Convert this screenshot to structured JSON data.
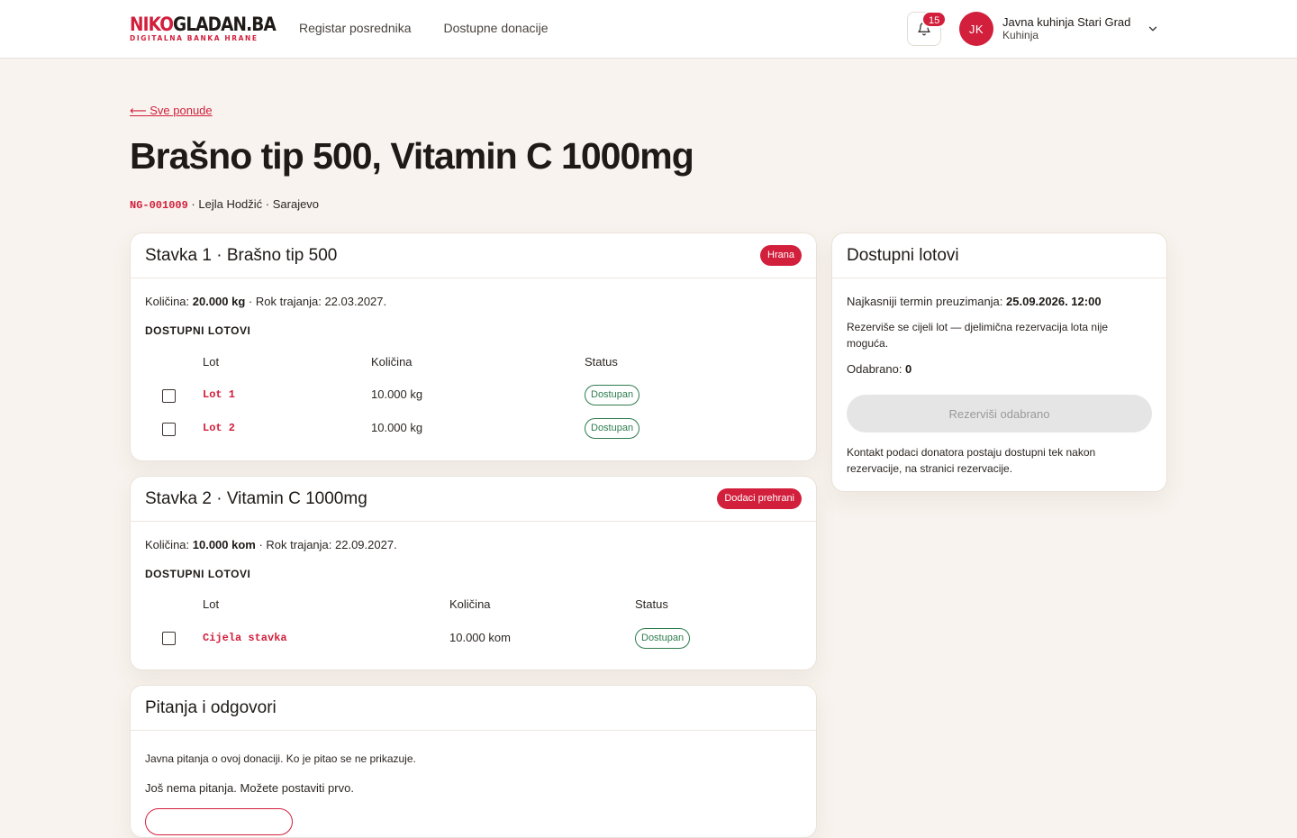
{
  "header": {
    "logo_main_red": "NIKO",
    "logo_main_dark": "GLADAN.BA",
    "logo_sub": "DIGITALNA BANKA HRANE",
    "nav": [
      "Registar posrednika",
      "Dostupne donacije"
    ],
    "notifications_count": "15",
    "account": {
      "initials": "JK",
      "name": "Javna kuhinja Stari Grad",
      "role": "Kuhinja"
    }
  },
  "page": {
    "back_link": "⟵ Sve ponude",
    "title": "Brašno tip 500, Vitamin C 1000mg",
    "code": "NG-001009",
    "meta_rest": " · Lejla Hodžić · Sarajevo"
  },
  "items": [
    {
      "title": "Stavka 1 · Brašno tip 500",
      "tag": "Hrana",
      "qty_label": "Količina: ",
      "qty_value": "20.000 kg",
      "expiry": " · Rok trajanja: 22.03.2027.",
      "section_label": "DOSTUPNI LOTOVI",
      "columns": [
        "Lot",
        "Količina",
        "Status"
      ],
      "lots": [
        {
          "name": "Lot 1",
          "qty": "10.000 kg",
          "status": "Dostupan"
        },
        {
          "name": "Lot 2",
          "qty": "10.000 kg",
          "status": "Dostupan"
        }
      ]
    },
    {
      "title": "Stavka 2 · Vitamin C 1000mg",
      "tag": "Dodaci prehrani",
      "qty_label": "Količina: ",
      "qty_value": "10.000 kom",
      "expiry": " · Rok trajanja: 22.09.2027.",
      "section_label": "DOSTUPNI LOTOVI",
      "columns": [
        "Lot",
        "Količina",
        "Status"
      ],
      "lots": [
        {
          "name": "Cijela stavka",
          "qty": "10.000 kom",
          "status": "Dostupan"
        }
      ]
    }
  ],
  "qa": {
    "title": "Pitanja i odgovori",
    "intro": "Javna pitanja o ovoj donaciji. Ko je pitao se ne prikazuje.",
    "empty": "Još nema pitanja. Možete postaviti prvo."
  },
  "sidebar": {
    "title": "Dostupni lotovi",
    "deadline_label": "Najkasniji termin preuzimanja: ",
    "deadline_value": "25.09.2026. 12:00",
    "note": "Rezerviše se cijeli lot — djelimična rezervacija lota nije moguća.",
    "selected_label": "Odabrano: ",
    "selected_value": "0",
    "reserve_button": "Rezerviši odabrano",
    "contact_note": "Kontakt podaci donatora postaju dostupni tek nakon rezervacije, na stranici rezervacije."
  },
  "colors": {
    "brand": "#d21f3c",
    "status_green": "#2e7d4f",
    "background": "#f8f3ee"
  }
}
